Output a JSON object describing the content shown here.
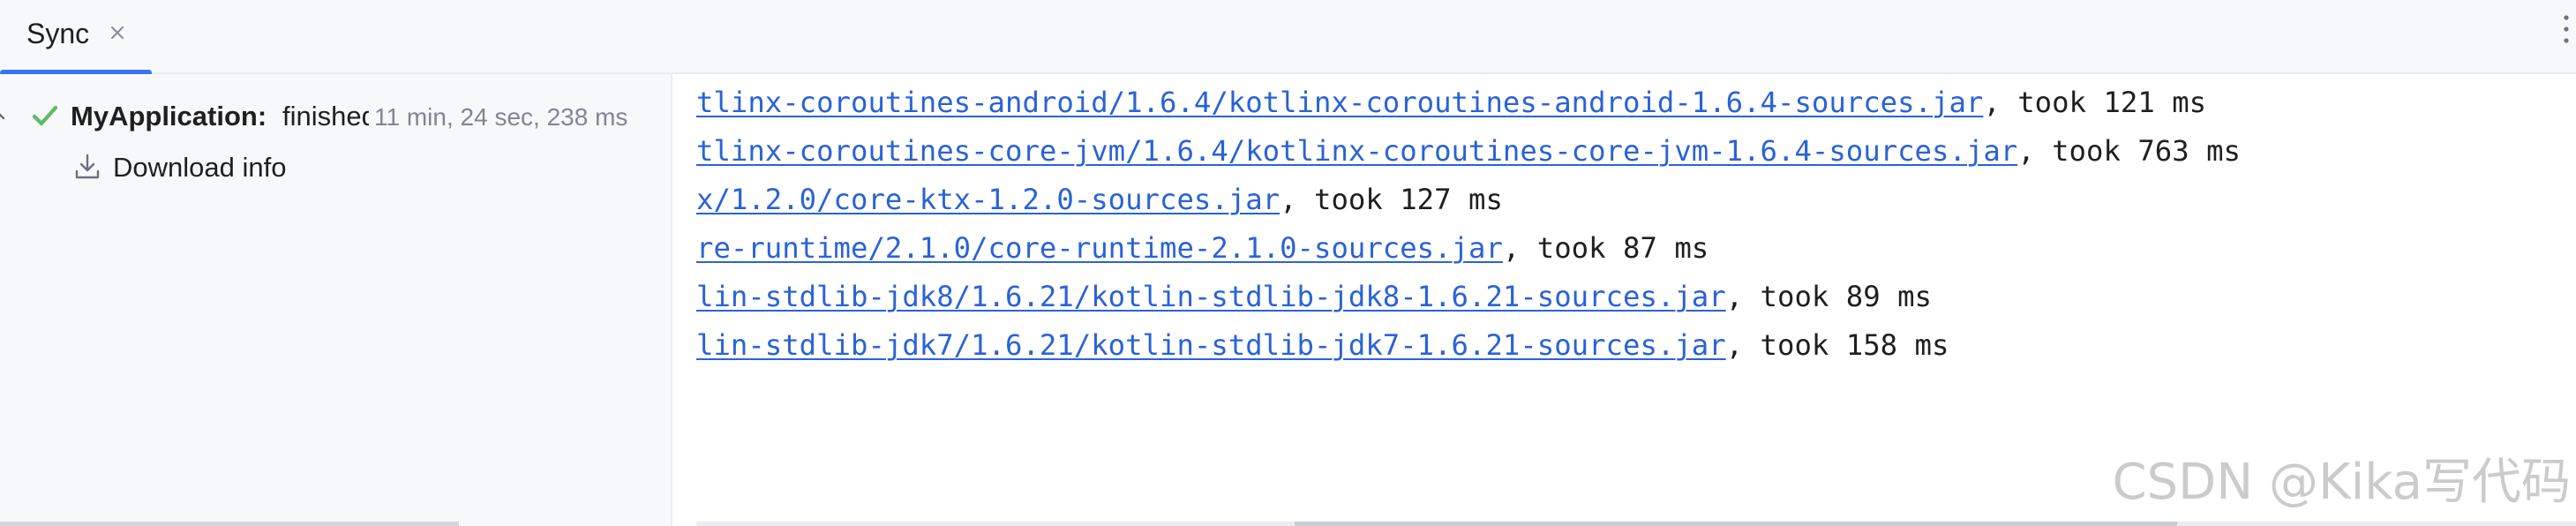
{
  "tab": {
    "label": "Sync",
    "close_icon": "close-icon"
  },
  "header": {
    "more_icon": "more-vertical-icon"
  },
  "tree": {
    "root": {
      "name": "MyApplication:",
      "status": "finished",
      "duration": "11 min, 24 sec, 238 ms",
      "icon": "success-check-icon"
    },
    "children": [
      {
        "label": "Download info",
        "icon": "download-icon"
      }
    ]
  },
  "console": {
    "lines": [
      {
        "link": "tlinx-coroutines-android/1.6.4/kotlinx-coroutines-android-1.6.4-sources.jar",
        "suffix": ", took 121 ms"
      },
      {
        "link": "tlinx-coroutines-core-jvm/1.6.4/kotlinx-coroutines-core-jvm-1.6.4-sources.jar",
        "suffix": ", took 763 ms"
      },
      {
        "link": "x/1.2.0/core-ktx-1.2.0-sources.jar",
        "suffix": ", took 127 ms"
      },
      {
        "link": "re-runtime/2.1.0/core-runtime-2.1.0-sources.jar",
        "suffix": ", took 87 ms"
      },
      {
        "link": "lin-stdlib-jdk8/1.6.21/kotlin-stdlib-jdk8-1.6.21-sources.jar",
        "suffix": ", took 89 ms"
      },
      {
        "link": "lin-stdlib-jdk7/1.6.21/kotlin-stdlib-jdk7-1.6.21-sources.jar",
        "suffix": ", took 158 ms"
      }
    ]
  },
  "watermark": "CSDN @Kika写代码",
  "colors": {
    "accent": "#3574f0",
    "link": "#2a62d8",
    "success": "#5fb865",
    "muted_text": "#818594",
    "panel_bg": "#f7f8fa"
  }
}
